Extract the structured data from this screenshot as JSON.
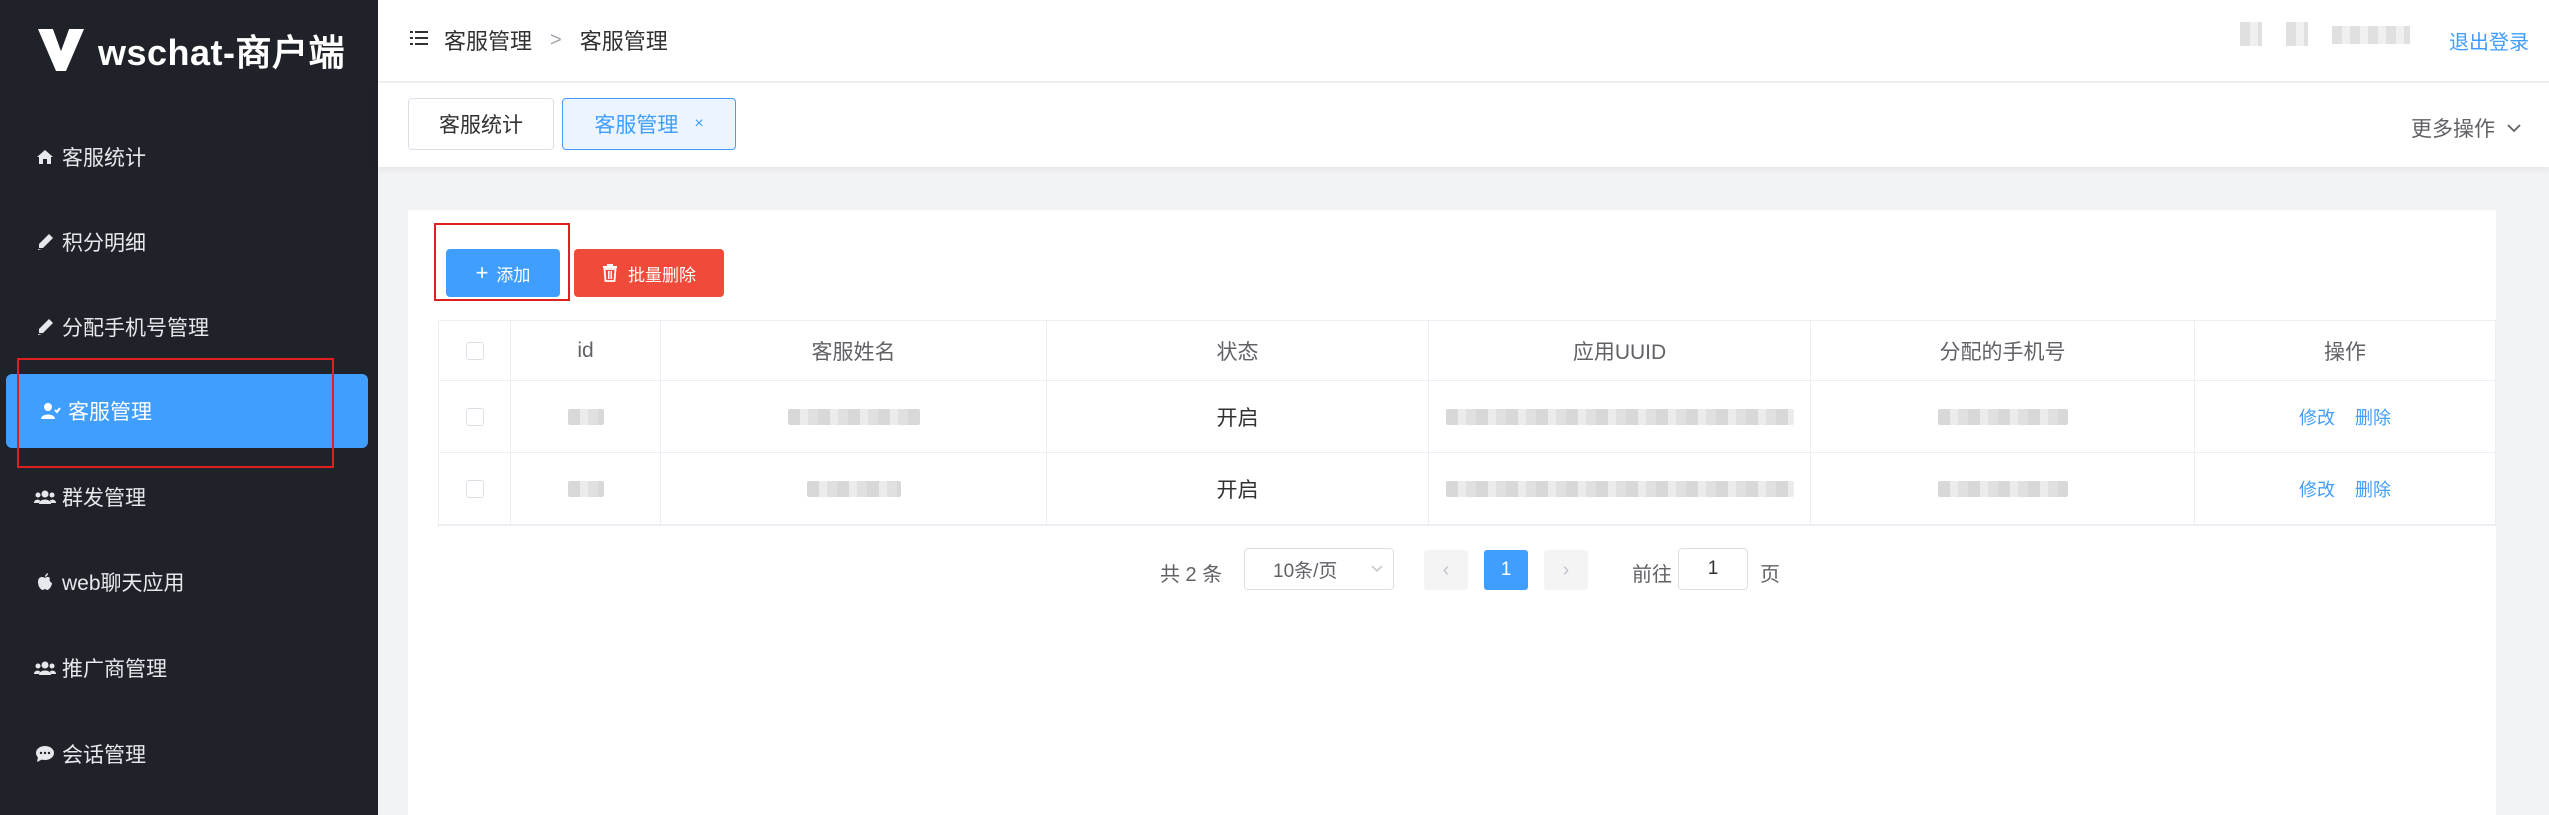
{
  "app": {
    "title": "wschat-商户端"
  },
  "sidebar": {
    "items": [
      {
        "label": "客服统计",
        "icon": "home-icon"
      },
      {
        "label": "积分明细",
        "icon": "pen-icon"
      },
      {
        "label": "分配手机号管理",
        "icon": "pen-icon"
      },
      {
        "label": "客服管理",
        "icon": "user-icon",
        "active": true
      },
      {
        "label": "群发管理",
        "icon": "users-icon"
      },
      {
        "label": "web聊天应用",
        "icon": "apple-icon"
      },
      {
        "label": "推广商管理",
        "icon": "users-icon"
      },
      {
        "label": "会话管理",
        "icon": "chat-icon"
      }
    ]
  },
  "header": {
    "breadcrumb": [
      "客服管理",
      "客服管理"
    ],
    "breadcrumb_sep": ">",
    "logout": "退出登录"
  },
  "tabs": {
    "items": [
      {
        "label": "客服统计"
      },
      {
        "label": "客服管理",
        "active": true,
        "close": "×"
      }
    ],
    "more_ops": "更多操作"
  },
  "toolbar": {
    "add_label": "添加",
    "batch_delete_label": "批量删除"
  },
  "table": {
    "columns": [
      "",
      "id",
      "客服姓名",
      "状态",
      "应用UUID",
      "分配的手机号",
      "操作"
    ],
    "rows": [
      {
        "status": "开启",
        "actions": [
          "修改",
          "删除"
        ]
      },
      {
        "status": "开启",
        "actions": [
          "修改",
          "删除"
        ]
      }
    ]
  },
  "pagination": {
    "total_text": "共 2 条",
    "page_size": "10条/页",
    "current_page": "1",
    "goto_label": "前往",
    "goto_value": "1",
    "goto_unit": "页",
    "prev": "‹",
    "next": "›"
  },
  "colors": {
    "primary": "#409eff",
    "danger": "#f04a3a",
    "sidebar_bg": "#1f2229"
  }
}
